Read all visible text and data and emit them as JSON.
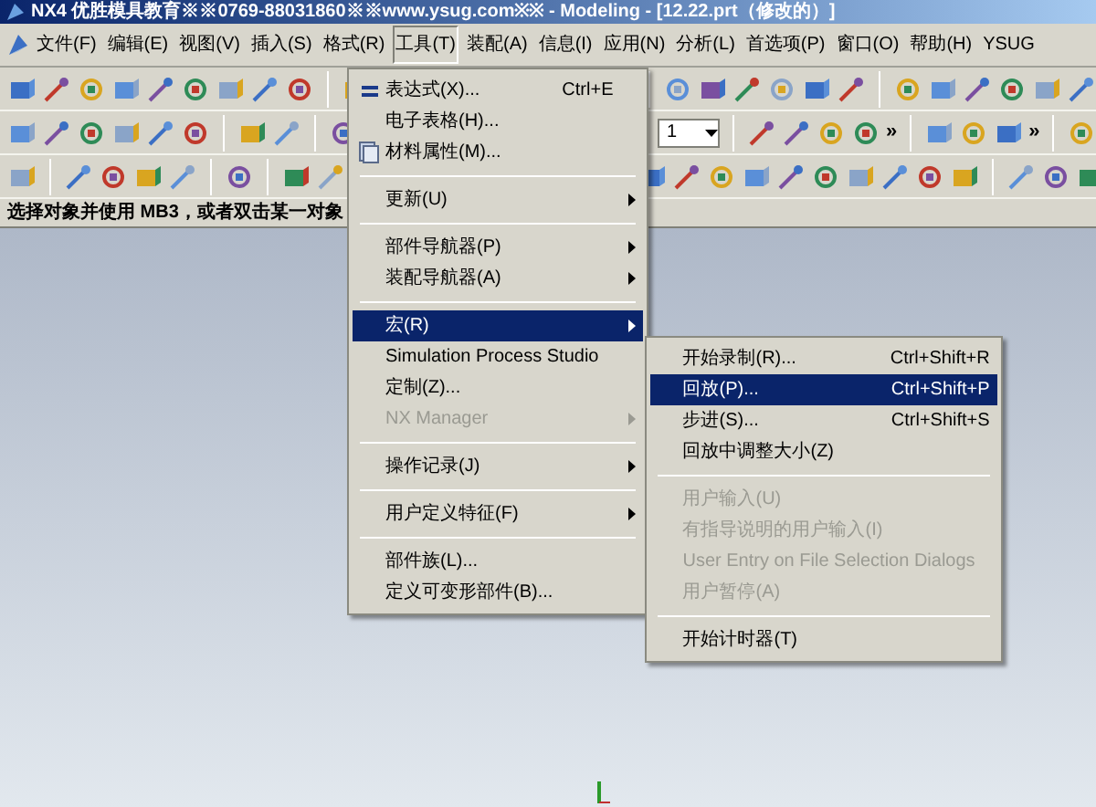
{
  "window": {
    "title": "NX4 优胜模具教育※※0769-88031860※※www.ysug.com※※ - Modeling - [12.22.prt（修改的）]"
  },
  "menu_bar": [
    {
      "label": "文件(F)",
      "selected": false
    },
    {
      "label": "编辑(E)",
      "selected": false
    },
    {
      "label": "视图(V)",
      "selected": false
    },
    {
      "label": "插入(S)",
      "selected": false
    },
    {
      "label": "格式(R)",
      "selected": false
    },
    {
      "label": "工具(T)",
      "selected": true
    },
    {
      "label": "装配(A)",
      "selected": false
    },
    {
      "label": "信息(I)",
      "selected": false
    },
    {
      "label": "应用(N)",
      "selected": false
    },
    {
      "label": "分析(L)",
      "selected": false
    },
    {
      "label": "首选项(P)",
      "selected": false
    },
    {
      "label": "窗口(O)",
      "selected": false
    },
    {
      "label": "帮助(H)",
      "selected": false
    },
    {
      "label": "YSUG",
      "selected": false
    }
  ],
  "toolbar": {
    "combo_value": "1",
    "overflow": [
      "»",
      "»"
    ]
  },
  "status_line": "选择对象并使用 MB3，或者双击某一对象",
  "tools_menu": [
    {
      "kind": "item",
      "label": "表达式(X)...",
      "shortcut": "Ctrl+E",
      "submenu": false,
      "disabled": false,
      "selected": false
    },
    {
      "kind": "item",
      "label": "电子表格(H)...",
      "submenu": false,
      "disabled": false,
      "selected": false
    },
    {
      "kind": "item",
      "label": "材料属性(M)...",
      "submenu": false,
      "disabled": false,
      "selected": false
    },
    {
      "kind": "separator"
    },
    {
      "kind": "item",
      "label": "更新(U)",
      "submenu": true,
      "disabled": false,
      "selected": false
    },
    {
      "kind": "separator"
    },
    {
      "kind": "item",
      "label": "部件导航器(P)",
      "submenu": true,
      "disabled": false,
      "selected": false
    },
    {
      "kind": "item",
      "label": "装配导航器(A)",
      "submenu": true,
      "disabled": false,
      "selected": false
    },
    {
      "kind": "separator"
    },
    {
      "kind": "item",
      "label": "宏(R)",
      "submenu": true,
      "disabled": false,
      "selected": true
    },
    {
      "kind": "item",
      "label": "Simulation Process Studio",
      "submenu": false,
      "disabled": false,
      "selected": false
    },
    {
      "kind": "item",
      "label": "定制(Z)...",
      "submenu": false,
      "disabled": false,
      "selected": false
    },
    {
      "kind": "item",
      "label": "NX Manager",
      "submenu": true,
      "disabled": true,
      "selected": false
    },
    {
      "kind": "separator"
    },
    {
      "kind": "item",
      "label": "操作记录(J)",
      "submenu": true,
      "disabled": false,
      "selected": false
    },
    {
      "kind": "separator"
    },
    {
      "kind": "item",
      "label": "用户定义特征(F)",
      "submenu": true,
      "disabled": false,
      "selected": false
    },
    {
      "kind": "separator"
    },
    {
      "kind": "item",
      "label": "部件族(L)...",
      "submenu": false,
      "disabled": false,
      "selected": false
    },
    {
      "kind": "item",
      "label": "定义可变形部件(B)...",
      "submenu": false,
      "disabled": false,
      "selected": false
    }
  ],
  "macro_submenu": [
    {
      "kind": "item",
      "label": "开始录制(R)...",
      "shortcut": "Ctrl+Shift+R",
      "disabled": false,
      "selected": false
    },
    {
      "kind": "item",
      "label": "回放(P)...",
      "shortcut": "Ctrl+Shift+P",
      "disabled": false,
      "selected": true
    },
    {
      "kind": "item",
      "label": "步进(S)...",
      "shortcut": "Ctrl+Shift+S",
      "disabled": false,
      "selected": false
    },
    {
      "kind": "item",
      "label": "回放中调整大小(Z)",
      "disabled": false,
      "selected": false
    },
    {
      "kind": "separator"
    },
    {
      "kind": "item",
      "label": "用户输入(U)",
      "disabled": true,
      "selected": false
    },
    {
      "kind": "item",
      "label": "有指导说明的用户输入(I)",
      "disabled": true,
      "selected": false
    },
    {
      "kind": "item",
      "label": "User Entry on File Selection Dialogs",
      "disabled": true,
      "selected": false
    },
    {
      "kind": "item",
      "label": "用户暂停(A)",
      "disabled": true,
      "selected": false
    },
    {
      "kind": "separator"
    },
    {
      "kind": "item",
      "label": "开始计时器(T)",
      "disabled": false,
      "selected": false
    }
  ]
}
